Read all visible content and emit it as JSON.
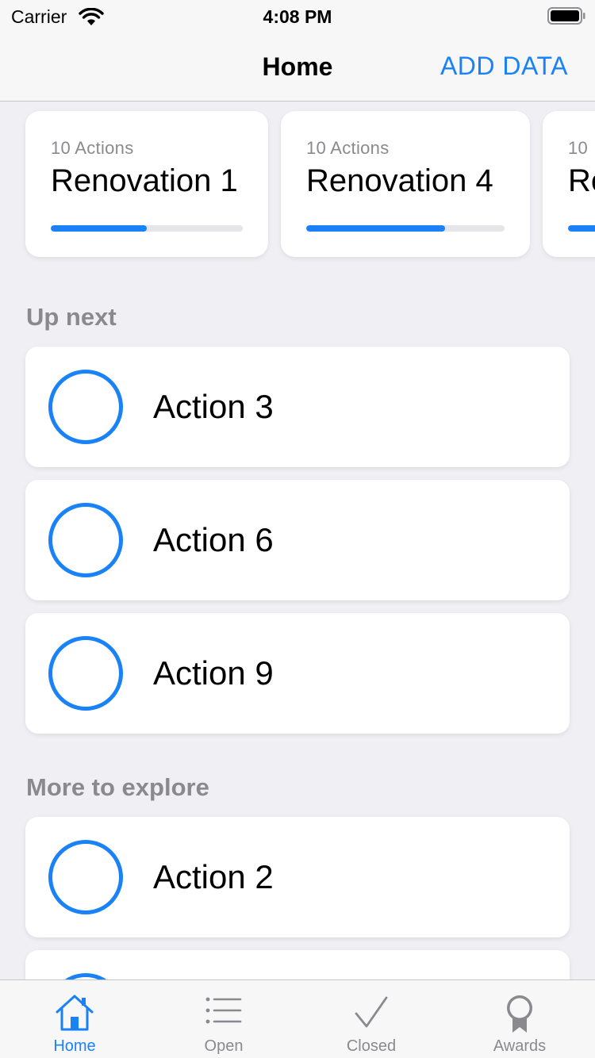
{
  "status_bar": {
    "carrier": "Carrier",
    "time": "4:08 PM",
    "icons": [
      "wifi-icon",
      "battery-icon"
    ]
  },
  "nav": {
    "title": "Home",
    "action_label": "ADD DATA"
  },
  "colors": {
    "accent": "#1a82f7",
    "secondary_text": "#8a8a8e",
    "background": "#efeff4"
  },
  "projects": [
    {
      "count": "10 Actions",
      "name": "Renovation 1",
      "progress": 0.5
    },
    {
      "count": "10 Actions",
      "name": "Renovation 4",
      "progress": 0.7
    },
    {
      "count": "10",
      "name": "Re",
      "progress": 0.5
    }
  ],
  "sections": {
    "up_next": {
      "title": "Up next",
      "items": [
        {
          "label": "Action 3"
        },
        {
          "label": "Action 6"
        },
        {
          "label": "Action 9"
        }
      ]
    },
    "more_to_explore": {
      "title": "More to explore",
      "items": [
        {
          "label": "Action 2"
        },
        {
          "label": ""
        }
      ]
    }
  },
  "tabs": [
    {
      "label": "Home",
      "icon": "house-icon",
      "active": true
    },
    {
      "label": "Open",
      "icon": "list-icon",
      "active": false
    },
    {
      "label": "Closed",
      "icon": "checkmark-icon",
      "active": false
    },
    {
      "label": "Awards",
      "icon": "award-icon",
      "active": false
    }
  ]
}
